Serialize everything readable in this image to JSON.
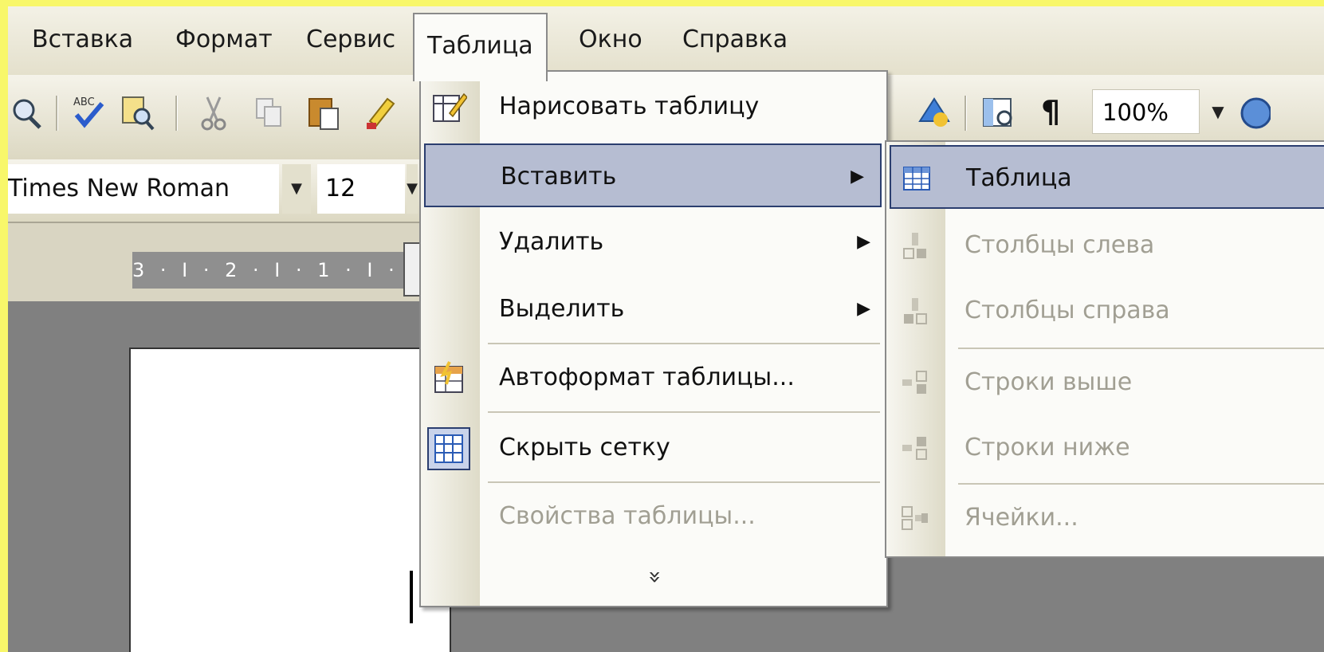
{
  "menubar": {
    "items": [
      {
        "label": "Вставка"
      },
      {
        "label": "Формат"
      },
      {
        "label": "Сервис"
      },
      {
        "label": "Таблица"
      },
      {
        "label": "Окно"
      },
      {
        "label": "Справка"
      }
    ]
  },
  "toolbar": {
    "zoom_value": "100%",
    "pilcrow": "¶"
  },
  "formatting": {
    "font_name": "Times New Roman",
    "font_size": "12"
  },
  "ruler": {
    "text": "3 · I · 2 · I · 1 · I ·"
  },
  "table_menu": {
    "items": [
      {
        "label": "Нарисовать таблицу",
        "icon": "draw-table-icon",
        "enabled": true,
        "submenu": false
      },
      {
        "label": "Вставить",
        "icon": "",
        "enabled": true,
        "submenu": true,
        "highlighted": true
      },
      {
        "label": "Удалить",
        "icon": "",
        "enabled": true,
        "submenu": true
      },
      {
        "label": "Выделить",
        "icon": "",
        "enabled": true,
        "submenu": true
      },
      {
        "label": "Автоформат таблицы...",
        "icon": "autoformat-table-icon",
        "enabled": true,
        "submenu": false
      },
      {
        "label": "Скрыть сетку",
        "icon": "hide-gridlines-icon",
        "enabled": true,
        "submenu": false
      },
      {
        "label": "Свойства таблицы...",
        "icon": "",
        "enabled": false,
        "submenu": false
      }
    ],
    "expand_glyph": "»"
  },
  "insert_submenu": {
    "items": [
      {
        "label": "Таблица",
        "icon": "table-icon",
        "enabled": true,
        "highlighted": true
      },
      {
        "label": "Столбцы слева",
        "icon": "columns-left-icon",
        "enabled": false
      },
      {
        "label": "Столбцы справа",
        "icon": "columns-right-icon",
        "enabled": false
      },
      {
        "label": "Строки выше",
        "icon": "rows-above-icon",
        "enabled": false
      },
      {
        "label": "Строки ниже",
        "icon": "rows-below-icon",
        "enabled": false
      },
      {
        "label": "Ячейки...",
        "icon": "cells-icon",
        "enabled": false
      }
    ]
  },
  "colors": {
    "frame": "#f8f76a",
    "highlight_fill": "#b6bdd2",
    "highlight_border": "#2b3e6f",
    "disabled_text": "#a19f93"
  }
}
